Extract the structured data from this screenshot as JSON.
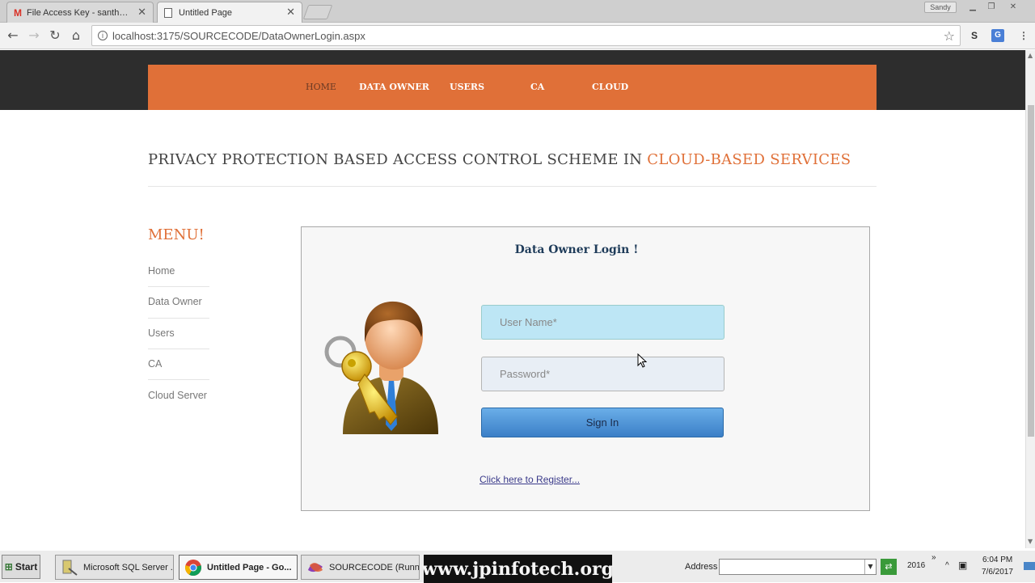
{
  "browser": {
    "tabs": [
      {
        "title": "File Access Key - santhanam",
        "icon": "gmail-icon"
      },
      {
        "title": "Untitled Page",
        "icon": "page-icon"
      }
    ],
    "profile_name": "Sandy",
    "url": "localhost:3175/SOURCECODE/DataOwnerLogin.aspx"
  },
  "page": {
    "nav": [
      "HOME",
      "DATA OWNER",
      "USERS",
      "CA",
      "CLOUD"
    ],
    "title_main": "PRIVACY PROTECTION BASED ACCESS CONTROL SCHEME IN ",
    "title_accent": "CLOUD-BASED SERVICES",
    "menu_heading": "MENU!",
    "menu": [
      "Home",
      "Data Owner",
      "Users",
      "CA",
      "Cloud Server"
    ],
    "login": {
      "title": "Data Owner Login !",
      "username_placeholder": "User Name*",
      "password_placeholder": "Password*",
      "signin_label": "Sign In",
      "register_link": "Click here to Register..."
    }
  },
  "taskbar": {
    "start_label": "Start",
    "tasks": [
      {
        "label": "Microsoft SQL Server ...",
        "icon": "sql-server-icon"
      },
      {
        "label": "Untitled Page - Go...",
        "icon": "chrome-icon",
        "active": true
      },
      {
        "label": "SOURCECODE (Runni...",
        "icon": "visual-studio-icon"
      }
    ],
    "banner": "www.jpinfotech.org",
    "address_label": "Address",
    "year": "2016",
    "time": "6:04 PM",
    "date": "7/6/2017"
  },
  "colors": {
    "accent_orange": "#e07038",
    "dark_band": "#2d2d2d",
    "username_bg": "#bde6f5",
    "signin_blue": "#3b7fc7"
  }
}
